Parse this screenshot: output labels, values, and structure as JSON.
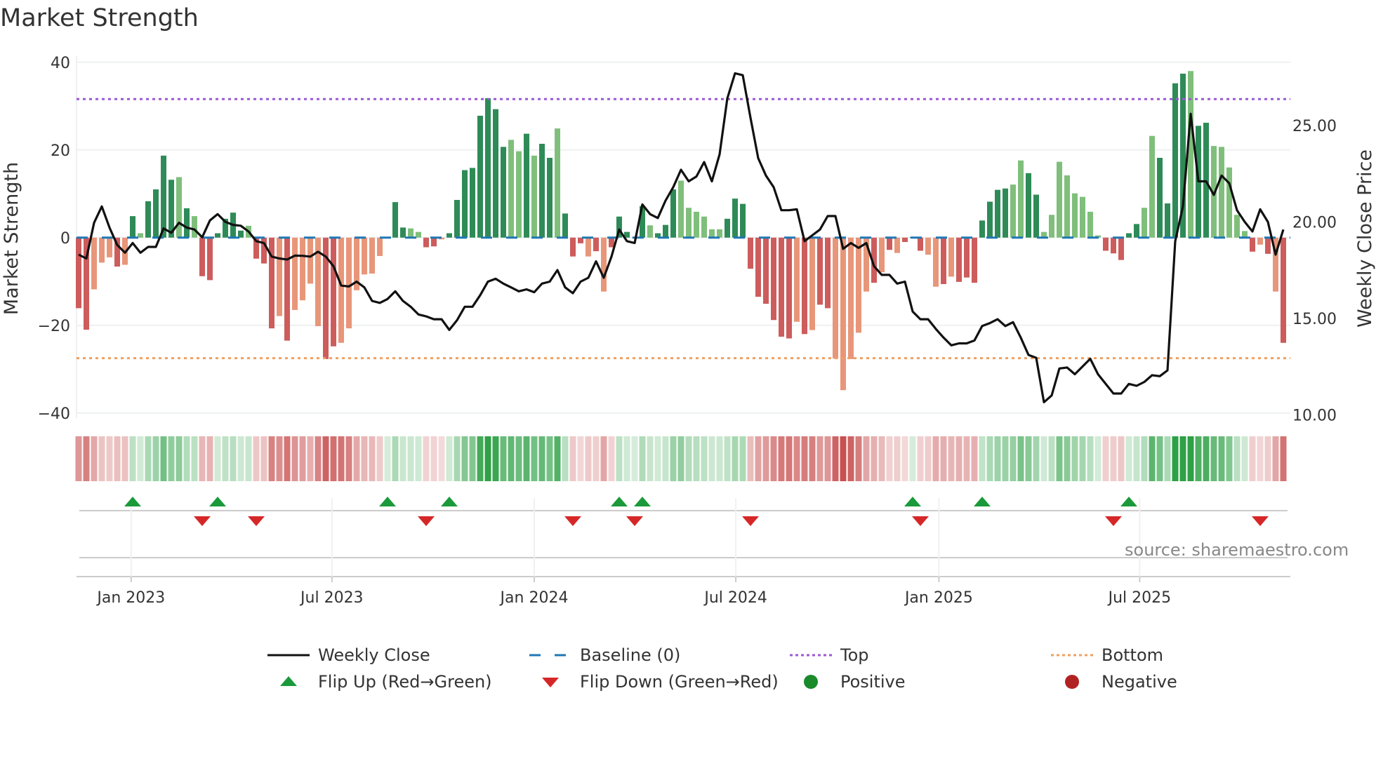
{
  "chart_data": {
    "type": "bar",
    "title": "Market Strength",
    "ylabel": "Market Strength",
    "y2label": "Weekly Close Price",
    "ylim": [
      -40,
      40
    ],
    "y2lim": [
      10,
      28.3
    ],
    "yticks": [
      "−40",
      "−20",
      "0",
      "20",
      "40"
    ],
    "yticks_values": [
      -40,
      -20,
      0,
      20,
      40
    ],
    "y2ticks": [
      "10.00",
      "15.00",
      "20.00",
      "25.00"
    ],
    "y2ticks_values": [
      10,
      15,
      20,
      25
    ],
    "xticks": [
      "Jan 2023",
      "Jul 2023",
      "Jan 2024",
      "Jul 2024",
      "Jan 2025",
      "Jul 2025"
    ],
    "xticks_week_index": [
      6.8,
      32.8,
      59,
      85.1,
      111.4,
      137.4
    ],
    "start_week": "2022-11-18",
    "frequency": "weekly",
    "top_level": 31.6,
    "bottom_level": -27.5,
    "baseline": 0,
    "strength": [
      -16.1,
      -21,
      -11.8,
      -5.7,
      -4.5,
      -6.6,
      -6.2,
      4.9,
      1,
      8.3,
      11,
      18.7,
      13.2,
      13.8,
      6.7,
      4.9,
      -8.8,
      -9.7,
      1,
      4.3,
      5.7,
      1.6,
      2.7,
      -4.8,
      -5.9,
      -20.7,
      -17.9,
      -23.5,
      -16.5,
      -14.3,
      -10.5,
      -20.2,
      -27.7,
      -24.8,
      -24,
      -20.7,
      -12,
      -8.4,
      -8.2,
      -4.2,
      0.2,
      8.1,
      2.3,
      2.1,
      1.3,
      -2.2,
      -2,
      -0.4,
      1,
      8.6,
      15.4,
      15.9,
      27.8,
      31.8,
      29.3,
      20.7,
      22.3,
      19.7,
      23.7,
      18.7,
      21.4,
      18.2,
      24.9,
      5.5,
      -4.3,
      -1.3,
      -4.3,
      -3.1,
      -12.3,
      -2.2,
      4.8,
      1.3,
      0.1,
      7.2,
      2.8,
      1,
      2.9,
      11,
      13,
      6.8,
      5.9,
      4.8,
      1.9,
      1.9,
      4.3,
      8.9,
      7.7,
      -7.1,
      -13.5,
      -15.1,
      -18.8,
      -22.6,
      -23,
      -19.2,
      -22,
      -21.1,
      -15.3,
      -16.1,
      -27.6,
      -34.8,
      -27.7,
      -21.7,
      -12.3,
      -10.3,
      -7.9,
      -2.8,
      -3.5,
      -1,
      0.1,
      -3,
      -3.9,
      -11.2,
      -10.6,
      -8.9,
      -10.1,
      -9.1,
      -10.3,
      3.9,
      8.2,
      10.9,
      11.2,
      12.1,
      17.6,
      14.7,
      9.8,
      1.3,
      5.2,
      17.3,
      14.2,
      10.1,
      9.3,
      5.9,
      0.5,
      -3,
      -3.6,
      -5.1,
      1,
      3.1,
      6.8,
      23.2,
      18.2,
      7.8,
      35.2,
      37.4,
      38,
      25.5,
      26.2,
      20.9,
      20.7,
      16,
      5.2,
      1.5,
      -3.2,
      -1.6,
      -3.7,
      -12.3,
      -24
    ],
    "strength_shade": "ddsssdsdlddddldlddddddldddsdssssddsssssssddllldsssddddddlldlddldldsdsdsdldldddlllllldddddddddsdsddsssssdsdsdddssdsdddddddllddlllllllldddddllddddlddllllllsdsdd",
    "weekly_close": [
      18.3,
      18.1,
      19.95,
      20.8,
      19.7,
      18.8,
      18.4,
      18.9,
      18.4,
      18.7,
      18.7,
      19.66,
      19.43,
      19.95,
      19.7,
      19.6,
      19.2,
      20.07,
      20.4,
      20,
      19.84,
      19.8,
      19.5,
      19,
      18.9,
      18.2,
      18.1,
      18.05,
      18.25,
      18.24,
      18.2,
      18.45,
      18.2,
      17.7,
      16.7,
      16.65,
      16.9,
      16.6,
      15.9,
      15.8,
      16,
      16.4,
      15.9,
      15.6,
      15.2,
      15.1,
      14.95,
      14.95,
      14.4,
      14.9,
      15.6,
      15.6,
      16.2,
      16.9,
      17.05,
      16.8,
      16.6,
      16.4,
      16.5,
      16.35,
      16.8,
      16.9,
      17.5,
      16.6,
      16.3,
      16.9,
      17.1,
      17.95,
      17.1,
      18.2,
      19.6,
      19,
      18.9,
      20.9,
      20.4,
      20.2,
      21.1,
      21.8,
      22.7,
      22.1,
      22.35,
      23.1,
      22.1,
      23.5,
      26.4,
      27.7,
      27.6,
      25.4,
      23.3,
      22.4,
      21.8,
      20.6,
      20.6,
      20.65,
      19,
      19.3,
      19.6,
      20.3,
      20.3,
      18.6,
      18.9,
      18.65,
      18.9,
      17.7,
      17.25,
      17.25,
      16.8,
      16.9,
      15.35,
      14.95,
      14.95,
      14.45,
      14,
      13.6,
      13.7,
      13.7,
      13.85,
      14.6,
      14.75,
      14.95,
      14.6,
      14.8,
      14,
      13.1,
      12.95,
      10.65,
      11,
      12.4,
      12.45,
      12.1,
      12.5,
      12.9,
      12.1,
      11.6,
      11.1,
      11.1,
      11.6,
      11.5,
      11.7,
      12.05,
      12,
      12.3,
      19,
      20.8,
      25.6,
      22.1,
      22.1,
      21.4,
      22.4,
      22,
      20.6,
      20,
      19.5,
      20.65,
      20,
      18.3,
      19.6
    ],
    "flip_up_week_index": [
      7,
      18,
      40,
      48,
      70,
      73,
      108,
      117,
      136
    ],
    "flip_down_week_index": [
      16,
      23,
      45,
      64,
      72,
      87,
      109,
      134,
      153
    ],
    "legend": [
      {
        "label": "Weekly Close",
        "kind": "line"
      },
      {
        "label": "Baseline (0)",
        "kind": "dash"
      },
      {
        "label": "Top",
        "kind": "dot-top"
      },
      {
        "label": "Bottom",
        "kind": "dot-bottom"
      },
      {
        "label": "Flip Up (Red→Green)",
        "kind": "tri-up"
      },
      {
        "label": "Flip Down (Green→Red)",
        "kind": "tri-down"
      },
      {
        "label": "Positive",
        "kind": "circle-pos"
      },
      {
        "label": "Negative",
        "kind": "circle-neg"
      }
    ],
    "legend_placement": "bottom",
    "colors": {
      "dark_green": "#2e8b57",
      "light_green": "#7fbf7b",
      "red": "#cd5c5c",
      "salmon": "#e8967a",
      "baseline": "#1f77b4",
      "top": "#9b59d6",
      "bottom": "#f0a060",
      "close": "#111111",
      "flip_up": "#1a9a3a",
      "flip_down": "#d62728",
      "positive": "#1a8a2a",
      "negative": "#b22222"
    },
    "source": "source: sharemaestro.com"
  }
}
